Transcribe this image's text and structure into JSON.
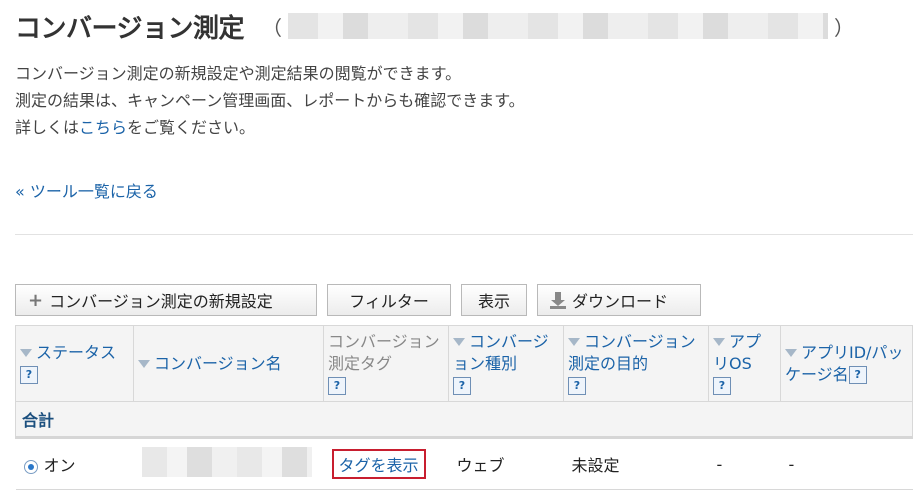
{
  "header": {
    "title": "コンバージョン測定",
    "paren_open": "（",
    "paren_close": "）"
  },
  "description": {
    "line1": "コンバージョン測定の新規設定や測定結果の閲覧ができます。",
    "line2": "測定の結果は、キャンペーン管理画面、レポートからも確認できます。",
    "line3_prefix": "詳しくは",
    "line3_link": "こちら",
    "line3_suffix": "をご覧ください。"
  },
  "back_link": "« ツール一覧に戻る",
  "toolbar": {
    "new_button": "コンバージョン測定の新規設定",
    "new_icon": "plus-icon",
    "filter_button": "フィルター",
    "display_button": "表示",
    "download_button": "ダウンロード",
    "download_icon": "download-icon"
  },
  "table": {
    "columns": [
      {
        "label": "ステータス",
        "sortable": true,
        "help": true
      },
      {
        "label": "コンバージョン名",
        "sortable": true,
        "help": false
      },
      {
        "label": "コンバージョン測定タグ",
        "sortable": false,
        "help": true
      },
      {
        "label": "コンバージョン種別",
        "sortable": true,
        "help": true
      },
      {
        "label": "コンバージョン測定の目的",
        "sortable": true,
        "help": true
      },
      {
        "label": "アプリOS",
        "sortable": true,
        "help": true
      },
      {
        "label": "アプリID/パッケージ名",
        "sortable": true,
        "help": true
      }
    ],
    "help_glyph": "?",
    "summary_label": "合計",
    "rows": [
      {
        "status": "オン",
        "tag_link": "タグを表示",
        "type": "ウェブ",
        "purpose": "未設定",
        "app_os": "-",
        "app_id": "-"
      }
    ]
  }
}
